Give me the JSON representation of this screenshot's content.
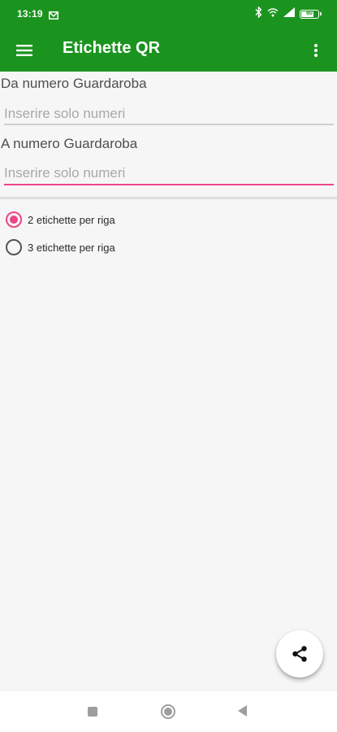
{
  "status_bar": {
    "time": "13:19",
    "battery": "80",
    "battery_level": 0.8,
    "icons": [
      "mail-icon",
      "bluetooth-icon",
      "wifi-icon",
      "signal-icon",
      "battery-icon"
    ]
  },
  "toolbar": {
    "title": "Etichette QR",
    "background_color": "#1b941f",
    "icons": [
      "menu-icon",
      "more-vert-icon"
    ]
  },
  "form": {
    "from_field": {
      "label": "Da numero Guardaroba",
      "placeholder": "Inserire solo numeri",
      "value": ""
    },
    "to_field": {
      "label": "A numero Guardaroba",
      "placeholder": "Inserire solo numeri",
      "value": "",
      "focused": true
    },
    "accent_color": "#ee4589"
  },
  "options": [
    {
      "label": "2 etichette per riga",
      "selected": true
    },
    {
      "label": "3 etichette per riga",
      "selected": false
    }
  ],
  "fab": {
    "icon": "share-icon"
  },
  "nav_bar": {
    "icons": [
      "recents-icon",
      "home-icon",
      "back-icon"
    ]
  }
}
